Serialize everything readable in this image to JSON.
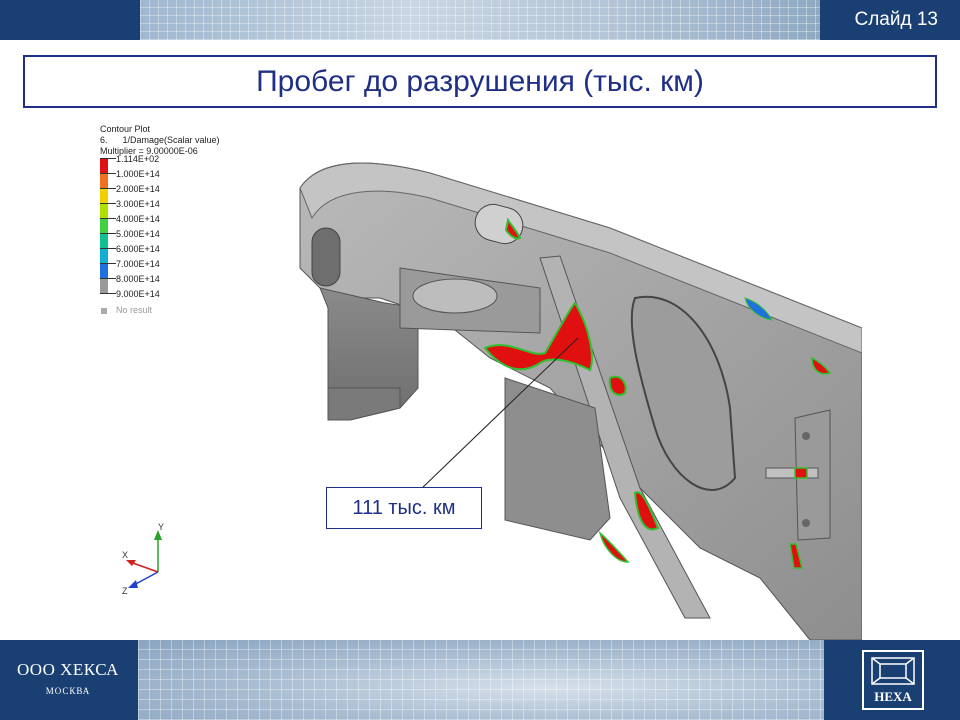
{
  "header": {
    "slide_label": "Слайд 13"
  },
  "title": "Пробег до разрушения (тыс. км)",
  "legend": {
    "line1": "Contour Plot",
    "line2": "6.      1/Damage(Scalar value)",
    "line3": "Multiplier = 9.00000E-06",
    "levels": [
      {
        "label": "1.114E+02",
        "color": "#e01010"
      },
      {
        "label": "1.000E+14",
        "color": "#f07020"
      },
      {
        "label": "2.000E+14",
        "color": "#f0d000"
      },
      {
        "label": "3.000E+14",
        "color": "#b0e000"
      },
      {
        "label": "4.000E+14",
        "color": "#40d040"
      },
      {
        "label": "5.000E+14",
        "color": "#10c090"
      },
      {
        "label": "6.000E+14",
        "color": "#10b0d0"
      },
      {
        "label": "7.000E+14",
        "color": "#2070e0"
      },
      {
        "label": "8.000E+14",
        "color": "#9a9a9a"
      },
      {
        "label": "9.000E+14",
        "color": ""
      }
    ],
    "no_result": "No result"
  },
  "callout": "111 тыс. км",
  "axes": {
    "x": "X",
    "y": "Y",
    "z": "Z"
  },
  "footer": {
    "company": "ООО ХЕКСА",
    "city": "МОСКВА",
    "logo_text": "HEXA"
  },
  "colors": {
    "brand_blue": "#1a3f73",
    "title_blue": "#1f2f86",
    "damage_red": "#e01010"
  }
}
